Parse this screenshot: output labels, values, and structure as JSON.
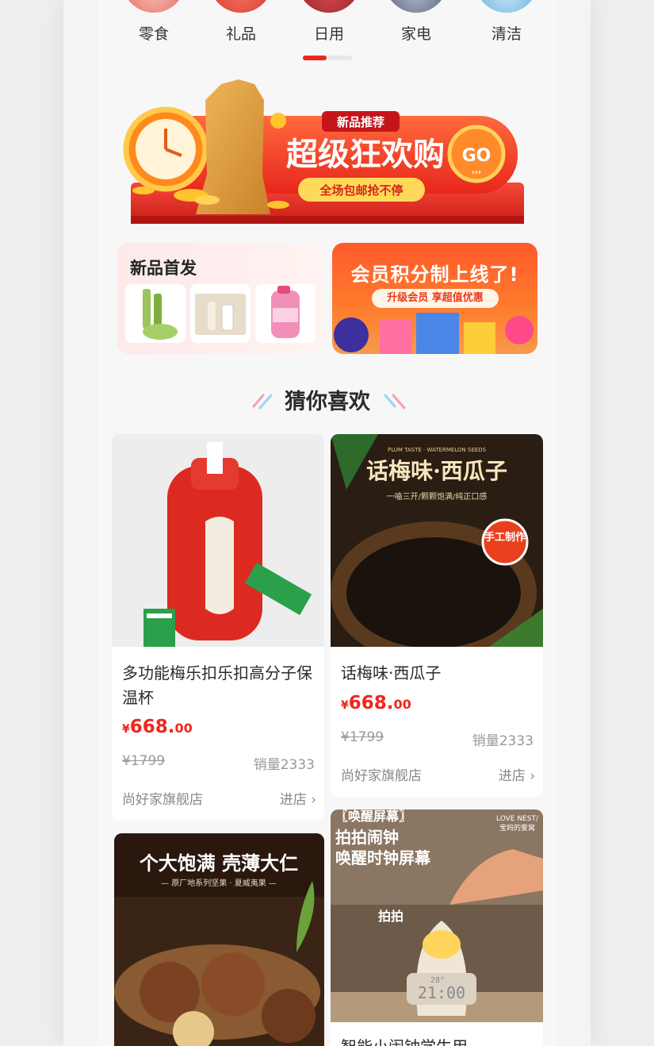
{
  "categories": [
    {
      "label": "零食",
      "color": "#e0463c"
    },
    {
      "label": "礼品",
      "color": "#d83a2f"
    },
    {
      "label": "日用",
      "color": "#b8262a"
    },
    {
      "label": "家电",
      "color": "#6b7488"
    },
    {
      "label": "清洁",
      "color": "#5aa8d8"
    }
  ],
  "banner": {
    "tag": "新品推荐",
    "headline": "超级狂欢购",
    "sub": "全场包邮抢不停",
    "go": "GO"
  },
  "promo_new": {
    "title": "新品首发"
  },
  "promo_member": {
    "title": "会员积分制上线了!",
    "sub": "升级会员 享超值优惠"
  },
  "section": {
    "title": "猜你喜欢"
  },
  "products": [
    {
      "name": "多功能梅乐扣乐扣高分子保温杯",
      "currency": "¥",
      "price_int": "668.",
      "price_dec": "00",
      "orig": "¥1799",
      "sales": "销量2333",
      "shop": "尚好家旗舰店",
      "enter": "进店 ›"
    },
    {
      "name": "话梅味·西瓜子",
      "currency": "¥",
      "price_int": "668.",
      "price_dec": "00",
      "orig": "¥1799",
      "sales": "销量2333",
      "shop": "尚好家旗舰店",
      "enter": "进店 ›",
      "img_title": "话梅味·西瓜子",
      "img_sub": "一嗑三开/颗颗饱满/纯正口感",
      "img_top": "PLUM TASTE · WATERMELON SEEDS",
      "badge": "手工制作"
    },
    {
      "name": "",
      "img_title": "个大饱满 壳薄大仁",
      "img_sub": "— 原厂地系列坚果 · 夏威夷果 —"
    },
    {
      "name": "智能小闹钟学生用",
      "img_tag": "〖唤醒屏幕〗",
      "img_title1": "拍拍闹钟",
      "img_title2": "唤醒时钟屏幕",
      "img_brand": "LOVE NEST/",
      "img_brand2": "宝妈的爱窝",
      "tap": "拍拍",
      "clock": "21:00",
      "temp": "28°"
    }
  ]
}
